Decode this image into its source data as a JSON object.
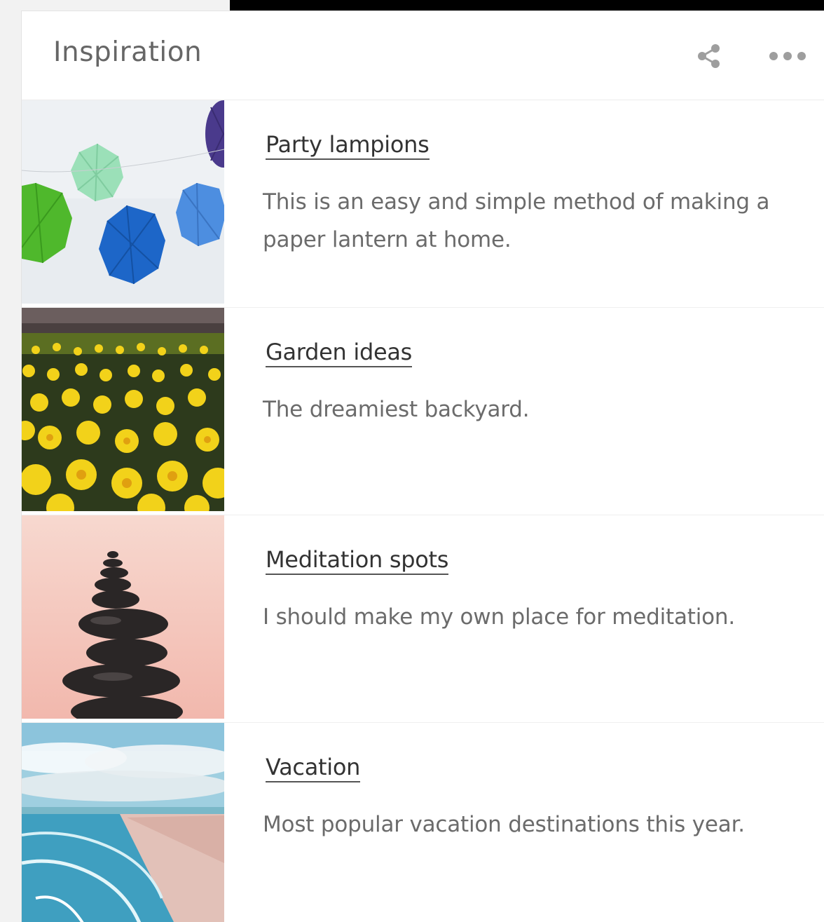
{
  "panel": {
    "title": "Inspiration",
    "icons": {
      "share": "share-icon",
      "more": "more-horizontal-icon"
    }
  },
  "items": [
    {
      "title": "Party lampions",
      "description": "This is an easy and simple method of making a paper lantern at home.",
      "image": "paper-lanterns-photo"
    },
    {
      "title": "Garden ideas",
      "description": "The dreamiest backyard.",
      "image": "daffodil-field-photo"
    },
    {
      "title": "Meditation spots",
      "description": "I should make my own place for meditation.",
      "image": "stacked-stones-photo"
    },
    {
      "title": "Vacation",
      "description": "Most popular vacation destinations this year.",
      "image": "beach-coast-photo"
    }
  ],
  "colors": {
    "title_text": "#333333",
    "description_text": "#6b6b6b",
    "header_text": "#666666",
    "icon": "#9e9e9e"
  }
}
